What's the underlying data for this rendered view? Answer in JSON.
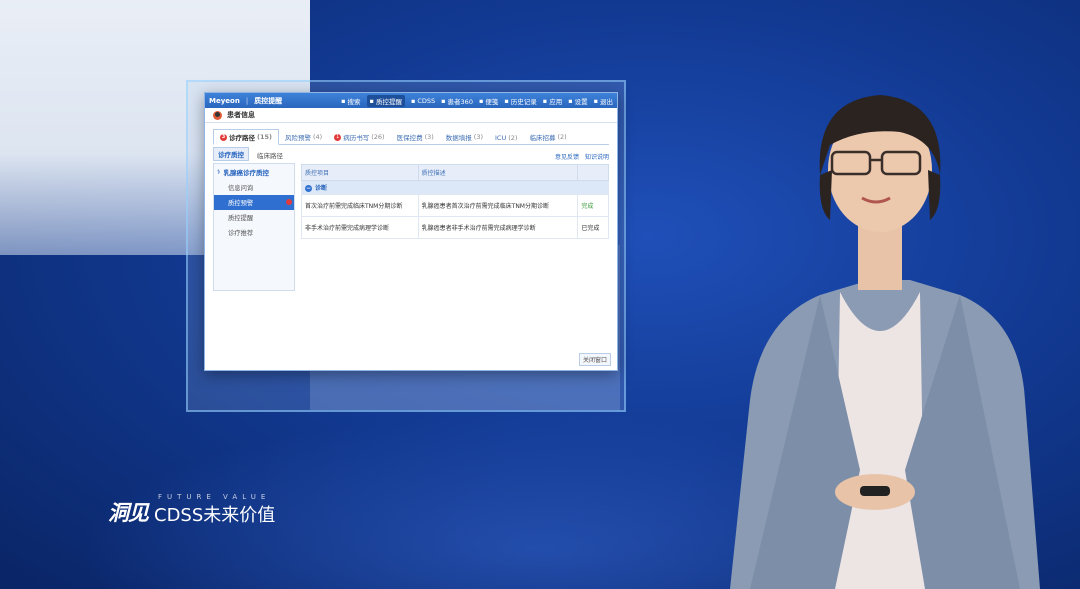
{
  "app": {
    "brand": "Meyeon",
    "title": "质控提醒",
    "toolbar": [
      {
        "label": "搜索",
        "icon": "search-icon",
        "active": false
      },
      {
        "label": "质控提醒",
        "icon": "alert-icon",
        "active": true
      },
      {
        "label": "CDSS",
        "icon": "cdss-icon",
        "active": false
      },
      {
        "label": "患者360",
        "icon": "patient-icon",
        "active": false
      },
      {
        "label": "便笺",
        "icon": "note-icon",
        "active": false
      },
      {
        "label": "历史记录",
        "icon": "history-icon",
        "active": false
      },
      {
        "label": "应用",
        "icon": "app-icon",
        "active": false
      },
      {
        "label": "设置",
        "icon": "gear-icon",
        "active": false
      },
      {
        "label": "退出",
        "icon": "exit-icon",
        "active": false
      }
    ]
  },
  "patient_bar": {
    "label": "患者信息"
  },
  "tabs": [
    {
      "label": "诊疗路径",
      "count": "(15)",
      "badge": "3",
      "active": true
    },
    {
      "label": "风险预警",
      "count": "(4)",
      "badge": "",
      "active": false
    },
    {
      "label": "病历书写",
      "count": "(26)",
      "badge": "1",
      "active": false
    },
    {
      "label": "医保控费",
      "count": "(3)",
      "badge": "",
      "active": false
    },
    {
      "label": "数据填报",
      "count": "(3)",
      "badge": "",
      "active": false
    },
    {
      "label": "ICU",
      "count": "(2)",
      "badge": "",
      "active": false
    },
    {
      "label": "临床招募",
      "count": "(2)",
      "badge": "",
      "active": false
    }
  ],
  "subtabs": [
    {
      "label": "诊疗质控",
      "active": true
    },
    {
      "label": "临床路径",
      "active": false
    }
  ],
  "tree": {
    "root": "乳腺癌诊疗质控",
    "items": [
      {
        "label": "信息问询",
        "active": false
      },
      {
        "label": "质控预警",
        "active": true
      },
      {
        "label": "质控提醒",
        "active": false
      },
      {
        "label": "诊疗推荐",
        "active": false
      }
    ]
  },
  "actions": {
    "feedback": "意见反馈",
    "docs": "知识说明"
  },
  "table": {
    "headers": [
      "质控项目",
      "质控描述",
      ""
    ],
    "group": "诊断",
    "rows": [
      {
        "item": "首次治疗前需完成临床TNM分期诊断",
        "desc": "乳腺癌患者首次治疗前需完成临床TNM分期诊断",
        "status": "完成"
      },
      {
        "item": "非手术治疗前需完成病理学诊断",
        "desc": "乳腺癌患者非手术治疗前需完成病理学诊断",
        "status": "已完成"
      }
    ]
  },
  "close_label": "关闭窗口",
  "logo": {
    "glyph": "洞见",
    "sub": "FUTURE VALUE",
    "main": "CDSS未来价值"
  }
}
